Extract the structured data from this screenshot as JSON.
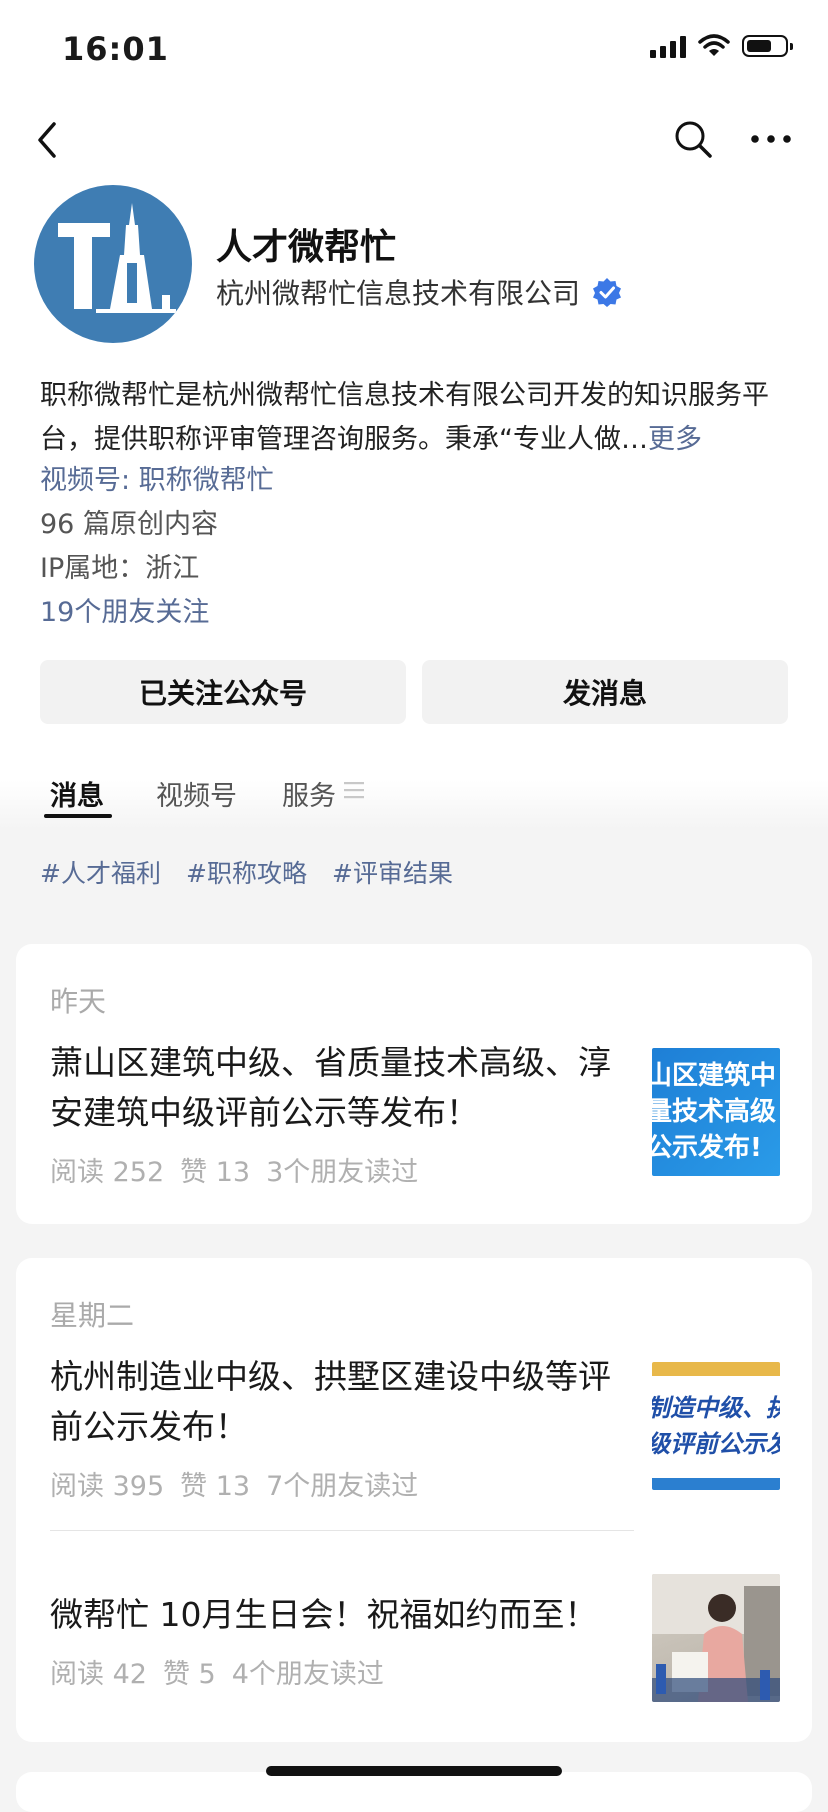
{
  "status_bar": {
    "time": "16:01"
  },
  "profile": {
    "name": "人才微帮忙",
    "company": "杭州微帮忙信息技术有限公司",
    "description": "职称微帮忙是杭州微帮忙信息技术有限公司开发的知识服务平台，提供职称评审管理咨询服务。秉承“专业人做…",
    "more_label": "更多",
    "video_channel": "视频号: 职称微帮忙",
    "original_count": "96 篇原创内容",
    "ip_location": "IP属地：浙江",
    "friends_following": "19个朋友关注"
  },
  "actions": {
    "follow_label": "已关注公众号",
    "message_label": "发消息"
  },
  "tabs": [
    {
      "label": "消息"
    },
    {
      "label": "视频号"
    },
    {
      "label": "服务"
    }
  ],
  "tags": [
    "#人才福利",
    "#职称攻略",
    "#评审结果"
  ],
  "groups": [
    {
      "date": "昨天",
      "articles": [
        {
          "title": "萧山区建筑中级、省质量技术高级、淳安建筑中级评前公示等发布！",
          "reads": "阅读 252",
          "likes": "赞 13",
          "friends_read": "3个朋友读过",
          "thumb_lines": [
            "山区建筑中",
            "量技术高级",
            "公示发布!"
          ]
        }
      ]
    },
    {
      "date": "星期二",
      "articles": [
        {
          "title": "杭州制造业中级、拱墅区建设中级等评前公示发布！",
          "reads": "阅读 395",
          "likes": "赞 13",
          "friends_read": "7个朋友读过",
          "thumb_lines": [
            "制造中级、拱",
            "级评前公示发"
          ]
        },
        {
          "title": "微帮忙 10月生日会！祝福如约而至！",
          "reads": "阅读 42",
          "likes": "赞 5",
          "friends_read": "4个朋友读过"
        }
      ]
    }
  ],
  "colors": {
    "link": "#576b95",
    "verified": "#3c78e6",
    "avatar_bg": "#3f7db3"
  }
}
